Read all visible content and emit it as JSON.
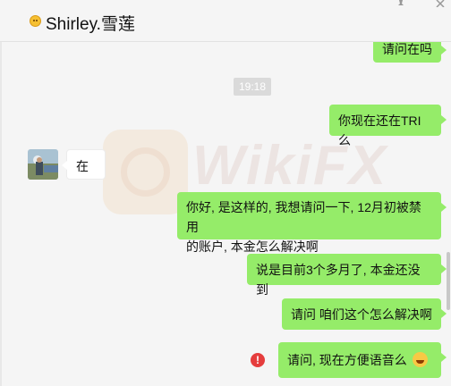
{
  "header": {
    "title": "Shirley.雪莲",
    "icons": [
      "smile-emoji-icon",
      "pin-icon",
      "close-icon"
    ]
  },
  "chat": {
    "messages": [
      {
        "side": "right",
        "text": "请问在吗"
      },
      {
        "side": "time",
        "text": "19:18"
      },
      {
        "side": "right",
        "text": "你现在还在TRI么"
      },
      {
        "side": "left",
        "text": "在"
      },
      {
        "side": "right",
        "text_line1": "你好, 是这样的, 我想请问一下, 12月初被禁用",
        "text_line2": "的账户, 本金怎么解决啊"
      },
      {
        "side": "right",
        "text": "说是目前3个多月了, 本金还没到"
      },
      {
        "side": "right",
        "text": "请问 咱们这个怎么解决啊"
      },
      {
        "side": "right",
        "text": "请问, 现在方便语音么",
        "status": "failed"
      }
    ]
  },
  "watermark": {
    "text": "WikiFX"
  },
  "colors": {
    "my_bubble": "#95ec69",
    "their_bubble": "#ffffff",
    "background": "#f5f5f5",
    "error": "#e53d3d"
  }
}
